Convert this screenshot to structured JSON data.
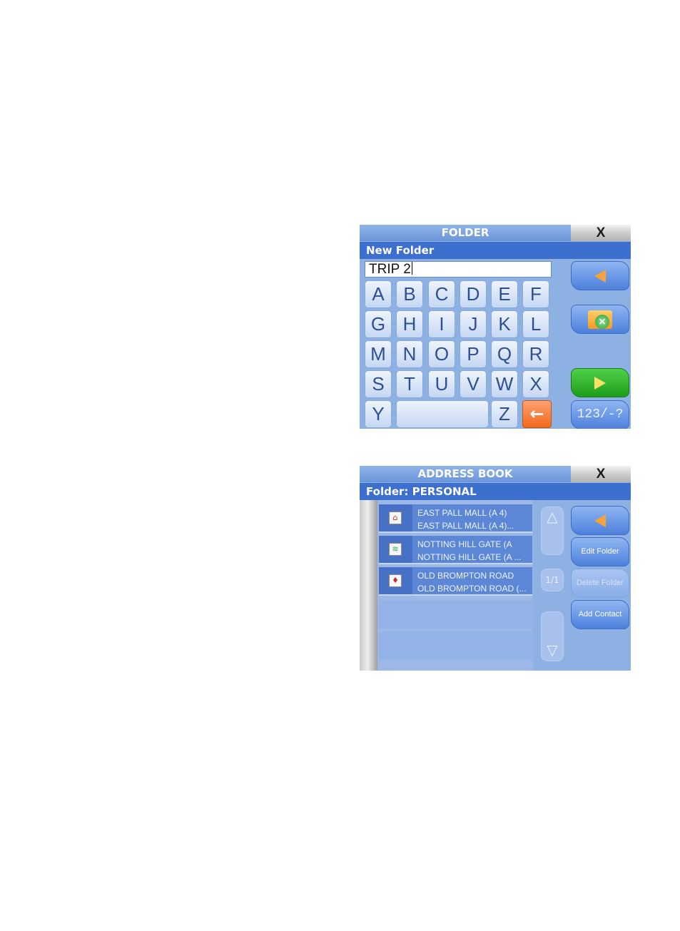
{
  "folder": {
    "title": "FOLDER",
    "close_label": "X",
    "subtitle": "New Folder",
    "input_value": "TRIP 2",
    "keys": {
      "row1": [
        "A",
        "B",
        "C",
        "D",
        "E",
        "F"
      ],
      "row2": [
        "G",
        "H",
        "I",
        "J",
        "K",
        "L"
      ],
      "row3": [
        "M",
        "N",
        "O",
        "P",
        "Q",
        "R"
      ],
      "row4": [
        "S",
        "T",
        "U",
        "V",
        "W",
        "X"
      ],
      "y": "Y",
      "z": "Z",
      "backspace": "←"
    },
    "mode_label": "123/-?",
    "icons": {
      "back": "back-arrow-icon",
      "delete_folder": "folder-delete-icon",
      "next": "next-arrow-icon"
    }
  },
  "address_book": {
    "title": "ADDRESS BOOK",
    "close_label": "X",
    "subtitle": "Folder: PERSONAL",
    "entries": [
      {
        "line1": "EAST PALL MALL (A 4)",
        "line2": "EAST PALL MALL (A 4)...",
        "icon": "home-icon",
        "glyph": "⌂"
      },
      {
        "line1": "NOTTING HILL GATE (A",
        "line2": "NOTTING HILL GATE (A ...",
        "icon": "map-icon",
        "glyph": "≋"
      },
      {
        "line1": "OLD BROMPTON ROAD",
        "line2": "OLD BROMPTON ROAD (...",
        "icon": "card-icon",
        "glyph": "♦"
      }
    ],
    "page_indicator": "1/1",
    "scroll_up": "△",
    "scroll_down": "▽",
    "buttons": {
      "edit_folder": "Edit Folder",
      "delete_folder": "Delete Folder",
      "add_contact": "Add Contact"
    }
  }
}
